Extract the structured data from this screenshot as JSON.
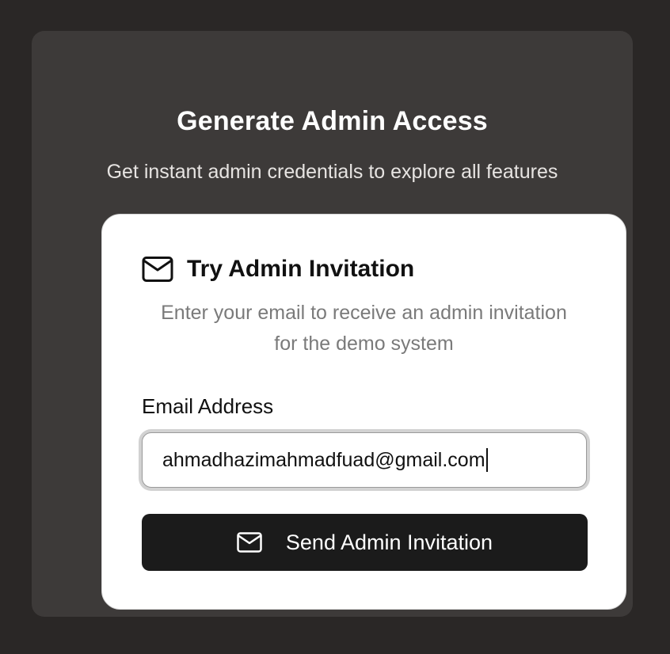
{
  "panel": {
    "title": "Generate Admin Access",
    "subtitle": "Get instant admin credentials to explore all features"
  },
  "card": {
    "header_icon": "mail-icon",
    "title": "Try Admin Invitation",
    "description": "Enter your email to receive an admin invitation for the demo system",
    "email_label": "Email Address",
    "email_value": "ahmadhazimahmadfuad@gmail.com",
    "send_button": {
      "icon": "mail-icon",
      "label": "Send Admin Invitation"
    }
  },
  "colors": {
    "background": "#2a2726",
    "panel": "#3d3a39",
    "card": "#ffffff",
    "button": "#1b1b1b"
  }
}
